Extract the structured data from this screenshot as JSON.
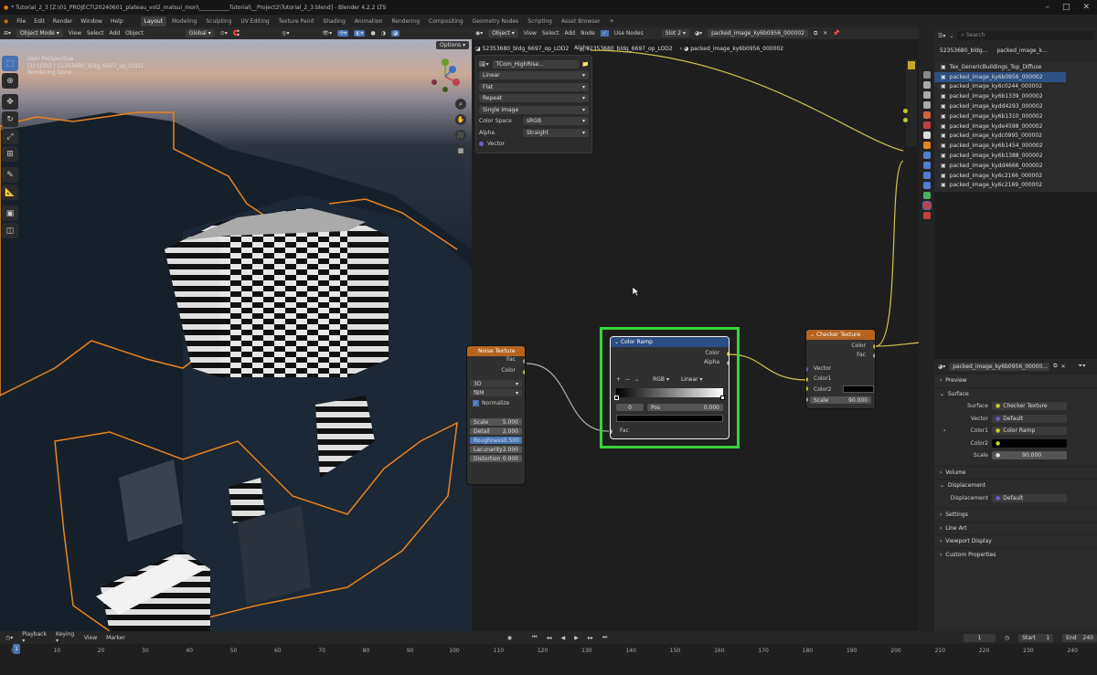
{
  "title": "* Tutorial_2_3 [Z:\\01_PROJECT\\20240601_plateau_vol2_matsui_mori\\___________Tutorial\\__Project2\\Tutorial_2_3.blend] - Blender 4.2.2 LTS",
  "menu": [
    "File",
    "Edit",
    "Render",
    "Window",
    "Help"
  ],
  "workspaces": [
    "Layout",
    "Modeling",
    "Sculpting",
    "UV Editing",
    "Texture Paint",
    "Shading",
    "Animation",
    "Rendering",
    "Compositing",
    "Geometry Nodes",
    "Scripting",
    "Asset Browser"
  ],
  "viewport": {
    "mode": "Object Mode",
    "menus": [
      "View",
      "Select",
      "Add",
      "Object"
    ],
    "orientation": "Global",
    "options": "Options",
    "info": [
      "User Perspective",
      "(1) LOD2 | 52353680_bldg_6697_op_LOD2",
      "Rendering Done"
    ]
  },
  "node_editor": {
    "mode": "Object",
    "menus": [
      "View",
      "Select",
      "Add",
      "Node"
    ],
    "use_nodes": "Use Nodes",
    "slot": "Slot 2",
    "image_name": "packed_image_ky6b0956_000002",
    "breadcrumb": [
      "52353680_bldg_6697_op_LOD2",
      "52353680_bldg_6697_op_LOD2",
      "packed_image_ky6b0956_000002"
    ],
    "image_panel": {
      "material": "TCom_HighRise...",
      "interp": "Linear",
      "proj": "Flat",
      "ext": "Repeat",
      "source": "Single Image",
      "cs_label": "Color Space",
      "cs": "sRGB",
      "alpha_label": "Alpha",
      "alpha": "Straight",
      "vector": "Vector",
      "alpha_out": "Alpha"
    },
    "noise": {
      "title": "Noise Texture",
      "fac": "Fac",
      "color": "Color",
      "norm": "Normalize",
      "dim": "3D",
      "type": "fBM",
      "rows": [
        {
          "label": "Scale",
          "value": "5.000"
        },
        {
          "label": "Detail",
          "value": "2.000"
        },
        {
          "label": "Roughness",
          "value": "0.500"
        },
        {
          "label": "Lacunarity",
          "value": "2.000"
        },
        {
          "label": "Distortion",
          "value": "0.000"
        }
      ]
    },
    "ramp": {
      "title": "Color Ramp",
      "color": "Color",
      "alpha": "Alpha",
      "plus": "+",
      "minus": "−",
      "mode": "RGB",
      "interp": "Linear",
      "index": "0",
      "pos_label": "Pos",
      "pos": "0.000",
      "fac": "Fac"
    },
    "checker": {
      "title": "Checker Texture",
      "color": "Color",
      "fac": "Fac",
      "vector": "Vector",
      "color1": "Color1",
      "color2": "Color2",
      "scale_label": "Scale",
      "scale": "90.000"
    }
  },
  "outliner": {
    "header": "52353680_bldg...",
    "header2": "packed_image_k...",
    "search": "Search",
    "items": [
      "Tex_GenericBuildings_Top_Diffuse",
      "packed_image_ky6b0956_000002",
      "packed_image_ky6c0244_000002",
      "packed_image_ky6b1339_000002",
      "packed_image_kydd4293_000002",
      "packed_image_ky6b1310_000002",
      "packed_image_kyde4598_000002",
      "packed_image_kydc0995_000002",
      "packed_image_ky6b1454_000002",
      "packed_image_ky6b1388_000002",
      "packed_image_kydd4666_000002",
      "packed_image_ky6c2166_000002",
      "packed_image_ky6c2169_000002"
    ],
    "selected": 1
  },
  "properties": {
    "header": "packed_image_ky6b0956_00000...",
    "preview": "Preview",
    "surface": "Surface",
    "rows": [
      {
        "label": "Surface",
        "value": "Checker Texture"
      },
      {
        "label": "Vector",
        "value": "Default"
      },
      {
        "label": "Color1",
        "value": "Color Ramp"
      },
      {
        "label": "Color2",
        "value": ""
      },
      {
        "label": "Scale",
        "value": "90.000"
      }
    ],
    "sections": [
      "Volume",
      "Displacement"
    ],
    "disp_label": "Displacement",
    "disp_value": "Default",
    "more": [
      "Settings",
      "Line Art",
      "Viewport Display",
      "Custom Properties"
    ]
  },
  "timeline": {
    "menus": [
      "Playback",
      "Keying",
      "View",
      "Marker"
    ],
    "current": "1",
    "start_label": "Start",
    "start": "1",
    "end_label": "End",
    "end": "240",
    "ticks": [
      "0",
      "10",
      "20",
      "30",
      "40",
      "50",
      "60",
      "70",
      "80",
      "90",
      "100",
      "110",
      "120",
      "130",
      "140",
      "150",
      "160",
      "170",
      "180",
      "190",
      "200",
      "210",
      "220",
      "230",
      "240"
    ]
  },
  "colors": {
    "accent": "#4772b3",
    "highlight": "#37d43b",
    "node_header_orange": "#b5631f",
    "node_header_blue": "#2b4f84",
    "socket_yellow": "#c7c729",
    "socket_purple": "#6363c7",
    "socket_grey": "#a1a1a1",
    "wire": "#d2c24e"
  }
}
